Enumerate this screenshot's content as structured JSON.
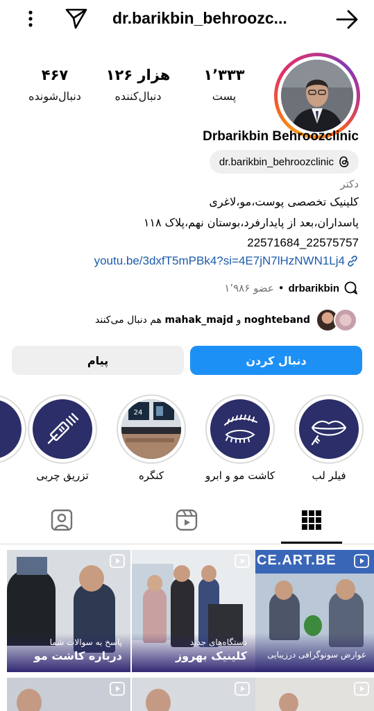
{
  "header": {
    "username": "dr.barikbin_behroozc...",
    "more_icon": "more-vertical-icon",
    "send_icon": "paper-plane-icon",
    "back_icon": "arrow-right-icon"
  },
  "stats": {
    "posts": {
      "value": "۱٬۳۳۳",
      "label": "پست"
    },
    "followers": {
      "value": "۱۲۶ هزار",
      "label": "دنبال‌کننده"
    },
    "following": {
      "value": "۴۶۷",
      "label": "دنبال‌شونده"
    }
  },
  "profile": {
    "name": "Drbarikbin Behroozclinic",
    "threads_badge": "dr.barikbin_behroozclinic",
    "category": "دکتر",
    "bio_line1": "کلینیک تخصصی پوست،مو،لاغری",
    "bio_line2": "پاسداران،بعد از پایدارفرد،بوستان نهم،پلاک ۱۱۸",
    "bio_line3": "22571684_22575757",
    "link": "youtu.be/3dxfT5mPBk4?si=4E7jN7lHzNWN1Lj4"
  },
  "threads": {
    "handle": "drbarikbin",
    "separator": "•",
    "members": "۱٬۹۸۶ عضو"
  },
  "followed_by": {
    "user1": "noghteband",
    "conj": "و",
    "user2": "mahak_majd",
    "suffix": "هم دنبال می‌کنند"
  },
  "buttons": {
    "follow": "دنبال کردن",
    "message": "پیام"
  },
  "highlights": [
    {
      "label": "فیلر لب",
      "icon": "lips-injection-icon"
    },
    {
      "label": "کاشت مو و ابرو",
      "icon": "eyebrow-icon"
    },
    {
      "label": "کنگره",
      "icon": "congress-photo"
    },
    {
      "label": "تزریق چربی",
      "icon": "syringe-icon"
    }
  ],
  "congress_slide_text": "24",
  "tabs": [
    {
      "name": "grid",
      "icon": "grid-icon",
      "active": true
    },
    {
      "name": "reels",
      "icon": "reels-icon",
      "active": false
    },
    {
      "name": "tagged",
      "icon": "tagged-person-icon",
      "active": false
    }
  ],
  "posts": [
    {
      "cap1": "عوارض سونوگرافی درزیبایی",
      "cap2": "",
      "banner": "CE.ART.BE"
    },
    {
      "cap1": "دستگاه‌های جدید",
      "cap2": "کلینیک بهروز"
    },
    {
      "cap1": "پاسخ به سوالات شما",
      "cap2": "درباره کاشت مو"
    }
  ],
  "colors": {
    "accent_blue": "#1d90f5",
    "link_blue": "#1c5bab",
    "highlight_navy": "#2b2e68",
    "muted": "#737373"
  }
}
